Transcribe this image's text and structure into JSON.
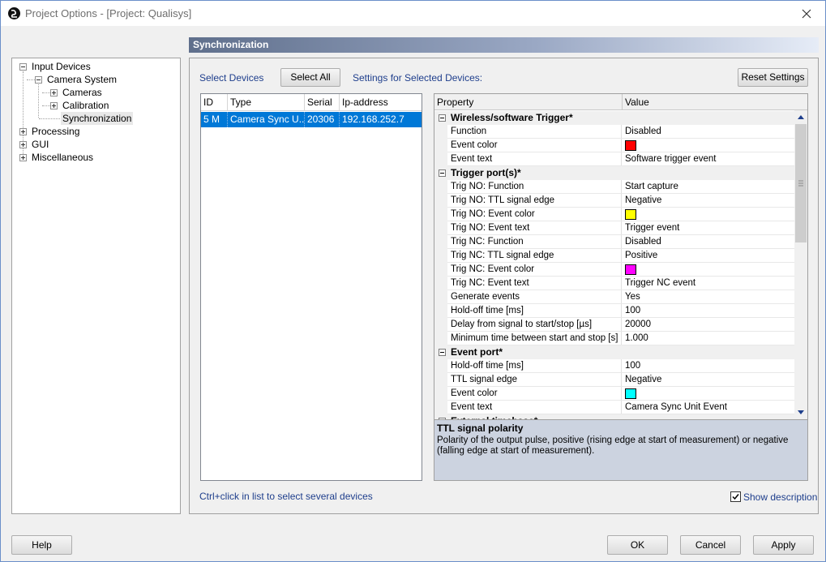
{
  "window": {
    "title": "Project Options - [Project: Qualisys]"
  },
  "section_header": "Synchronization",
  "tree": {
    "items": [
      {
        "label": "Input Devices"
      },
      {
        "label": "Camera System"
      },
      {
        "label": "Cameras"
      },
      {
        "label": "Calibration"
      },
      {
        "label": "Synchronization"
      },
      {
        "label": "Processing"
      },
      {
        "label": "GUI"
      },
      {
        "label": "Miscellaneous"
      }
    ]
  },
  "toolbar": {
    "select_devices_label": "Select Devices",
    "select_all_button": "Select All",
    "settings_label": "Settings for Selected Devices:",
    "reset_button": "Reset Settings"
  },
  "device_list": {
    "columns": [
      "ID",
      "Type",
      "Serial",
      "Ip-address"
    ],
    "rows": [
      {
        "id": "5 M",
        "type": "Camera Sync U...",
        "serial": "20306",
        "ip": "192.168.252.7"
      }
    ],
    "hint": "Ctrl+click in list to select several devices"
  },
  "property_grid": {
    "col_property": "Property",
    "col_value": "Value",
    "categories": [
      {
        "label": "Wireless/software Trigger*",
        "rows": [
          {
            "name": "Function",
            "value": "Disabled"
          },
          {
            "name": "Event color",
            "value": "",
            "color": "#ff0000"
          },
          {
            "name": "Event text",
            "value": "Software trigger event"
          }
        ]
      },
      {
        "label": "Trigger port(s)*",
        "rows": [
          {
            "name": "Trig NO: Function",
            "value": "Start capture"
          },
          {
            "name": "Trig NO: TTL signal edge",
            "value": "Negative"
          },
          {
            "name": "Trig NO: Event color",
            "value": "",
            "color": "#ffff00"
          },
          {
            "name": "Trig NO: Event text",
            "value": "Trigger event"
          },
          {
            "name": "Trig NC: Function",
            "value": "Disabled"
          },
          {
            "name": "Trig NC: TTL signal edge",
            "value": "Positive"
          },
          {
            "name": "Trig NC: Event color",
            "value": "",
            "color": "#ff00ff"
          },
          {
            "name": "Trig NC: Event text",
            "value": "Trigger NC event"
          },
          {
            "name": "Generate events",
            "value": "Yes"
          },
          {
            "name": "Hold-off time [ms]",
            "value": "100"
          },
          {
            "name": "Delay from signal to start/stop [µs]",
            "value": "20000"
          },
          {
            "name": "Minimum time between start and stop [s]",
            "value": "1.000"
          }
        ]
      },
      {
        "label": "Event port*",
        "rows": [
          {
            "name": "Hold-off time [ms]",
            "value": "100"
          },
          {
            "name": "TTL signal edge",
            "value": "Negative"
          },
          {
            "name": "Event color",
            "value": "",
            "color": "#00ffff"
          },
          {
            "name": "Event text",
            "value": "Camera Sync Unit Event"
          }
        ]
      },
      {
        "label": "External timebase*",
        "rows": []
      }
    ]
  },
  "description": {
    "title": "TTL signal polarity",
    "text": "Polarity of the output pulse, positive (rising edge at start of measurement) or negative (falling edge at start of measurement)."
  },
  "show_description": {
    "label": "Show description",
    "checked": true
  },
  "footer": {
    "help": "Help",
    "ok": "OK",
    "cancel": "Cancel",
    "apply": "Apply"
  },
  "colors": {
    "selection": "#0078d7",
    "header_gradient_start": "#5f6f8c",
    "description_bg": "#ccd3e0"
  }
}
